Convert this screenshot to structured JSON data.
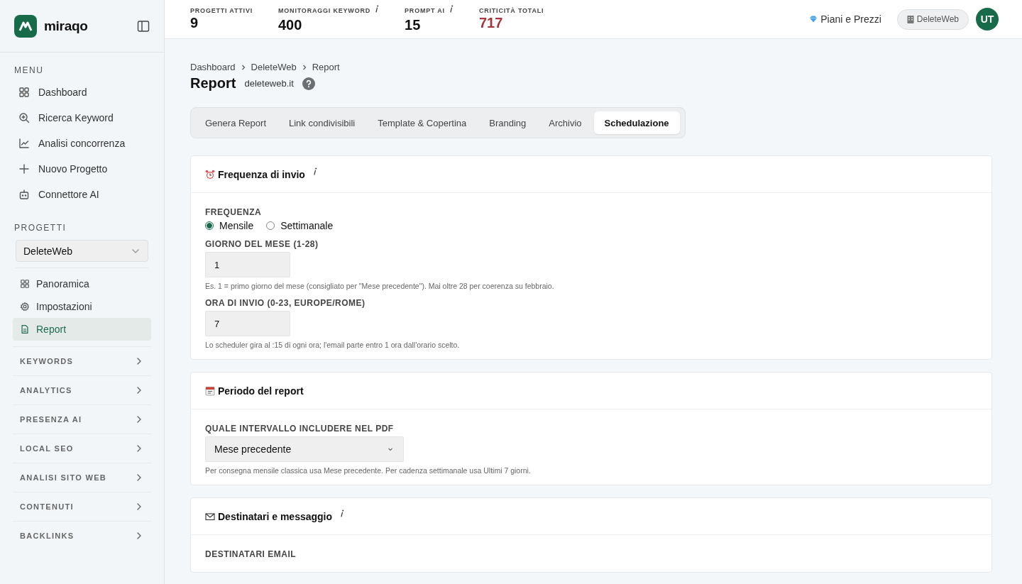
{
  "brand": {
    "name": "miraqo"
  },
  "sidebar": {
    "menu_heading": "MENU",
    "menu": [
      {
        "label": "Dashboard"
      },
      {
        "label": "Ricerca Keyword"
      },
      {
        "label": "Analisi concorrenza"
      },
      {
        "label": "Nuovo Progetto"
      },
      {
        "label": "Connettore AI"
      }
    ],
    "projects_heading": "PROGETTI",
    "project_select": {
      "value": "DeleteWeb"
    },
    "project_nav": [
      {
        "label": "Panoramica",
        "selected": false
      },
      {
        "label": "Impostazioni",
        "selected": false
      },
      {
        "label": "Report",
        "selected": true
      }
    ],
    "sections": [
      {
        "label": "KEYWORDS",
        "expanded": false
      },
      {
        "label": "ANALYTICS",
        "expanded": false
      },
      {
        "label": "PRESENZA AI",
        "expanded": false
      },
      {
        "label": "LOCAL SEO",
        "expanded": false
      },
      {
        "label": "ANALISI SITO WEB",
        "expanded": false
      },
      {
        "label": "CONTENUTI",
        "expanded": false
      },
      {
        "label": "BACKLINKS",
        "expanded": false
      }
    ]
  },
  "stats": [
    {
      "label": "PROGETTI ATTIVI",
      "value": "9",
      "info": false,
      "alert": false
    },
    {
      "label": "MONITORAGGI KEYWORD",
      "value": "400",
      "info": true,
      "alert": false
    },
    {
      "label": "PROMPT AI",
      "value": "15",
      "info": true,
      "alert": false
    },
    {
      "label": "CRITICITÀ TOTALI",
      "value": "717",
      "info": false,
      "alert": true
    }
  ],
  "topbar": {
    "pricing_link": "Piani e Prezzi",
    "workspace": "DeleteWeb",
    "avatar": "UT"
  },
  "breadcrumb": [
    "Dashboard",
    "DeleteWeb",
    "Report"
  ],
  "page": {
    "title": "Report",
    "domain": "deleteweb.it"
  },
  "tabs": [
    {
      "label": "Genera Report",
      "selected": false
    },
    {
      "label": "Link condivisibili",
      "selected": false
    },
    {
      "label": "Template & Copertina",
      "selected": false
    },
    {
      "label": "Branding",
      "selected": false
    },
    {
      "label": "Archivio",
      "selected": false
    },
    {
      "label": "Schedulazione",
      "selected": true
    }
  ],
  "cards": [
    {
      "title": "Frequenza di invio",
      "info": true,
      "fields": [
        {
          "kind": "radio",
          "label": "FREQUENZA",
          "options": [
            {
              "label": "Mensile",
              "selected": true
            },
            {
              "label": "Settimanale",
              "selected": false
            }
          ]
        },
        {
          "kind": "input",
          "label": "GIORNO DEL MESE (1-28)",
          "value": "1",
          "hint": "Es. 1 = primo giorno del mese (consigliato per \"Mese precedente\"). Mai oltre 28 per coerenza su febbraio."
        },
        {
          "kind": "input",
          "label": "ORA DI INVIO (0-23, EUROPE/ROME)",
          "value": "7",
          "hint": "Lo scheduler gira al :15 di ogni ora; l'email parte entro 1 ora dall'orario scelto."
        }
      ]
    },
    {
      "title": "Periodo del report",
      "info": false,
      "fields": [
        {
          "kind": "select",
          "label": "QUALE INTERVALLO INCLUDERE NEL PDF",
          "value": "Mese precedente",
          "hint": "Per consegna mensile classica usa Mese precedente. Per cadenza settimanale usa Ultimi 7 giorni."
        }
      ]
    },
    {
      "title": "Destinatari e messaggio",
      "info": true,
      "fields": [
        {
          "kind": "heading",
          "label": "DESTINATARI EMAIL"
        }
      ]
    }
  ]
}
